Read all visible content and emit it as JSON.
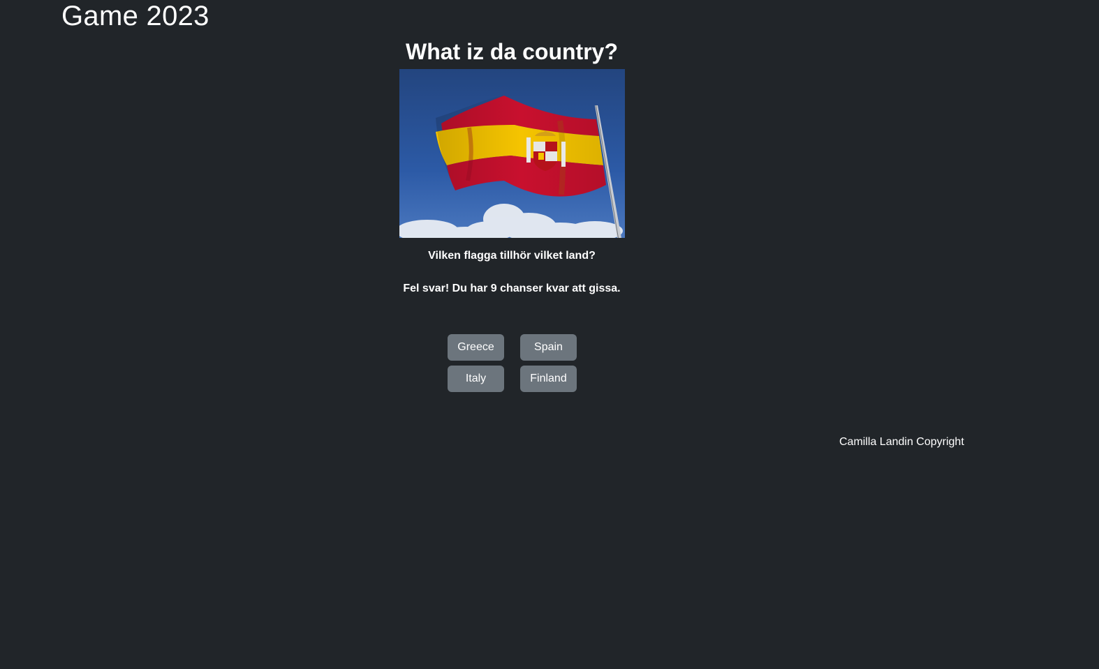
{
  "header": {
    "site_title": "Game 2023"
  },
  "game": {
    "heading": "What iz da country?",
    "image": {
      "depicts": "flag-of-spain",
      "colors": {
        "sky": "#2a4f94",
        "red": "#c8102e",
        "yellow": "#f5c400"
      }
    },
    "question": "Vilken flagga tillhör vilket land?",
    "feedback": "Fel svar! Du har 9 chanser kvar att gissa.",
    "answers": [
      "Greece",
      "Spain",
      "Italy",
      "Finland"
    ]
  },
  "footer": {
    "copyright": "Camilla Landin Copyright"
  },
  "theme": {
    "background": "#212529",
    "button": "#6c757d",
    "text": "#ffffff"
  }
}
